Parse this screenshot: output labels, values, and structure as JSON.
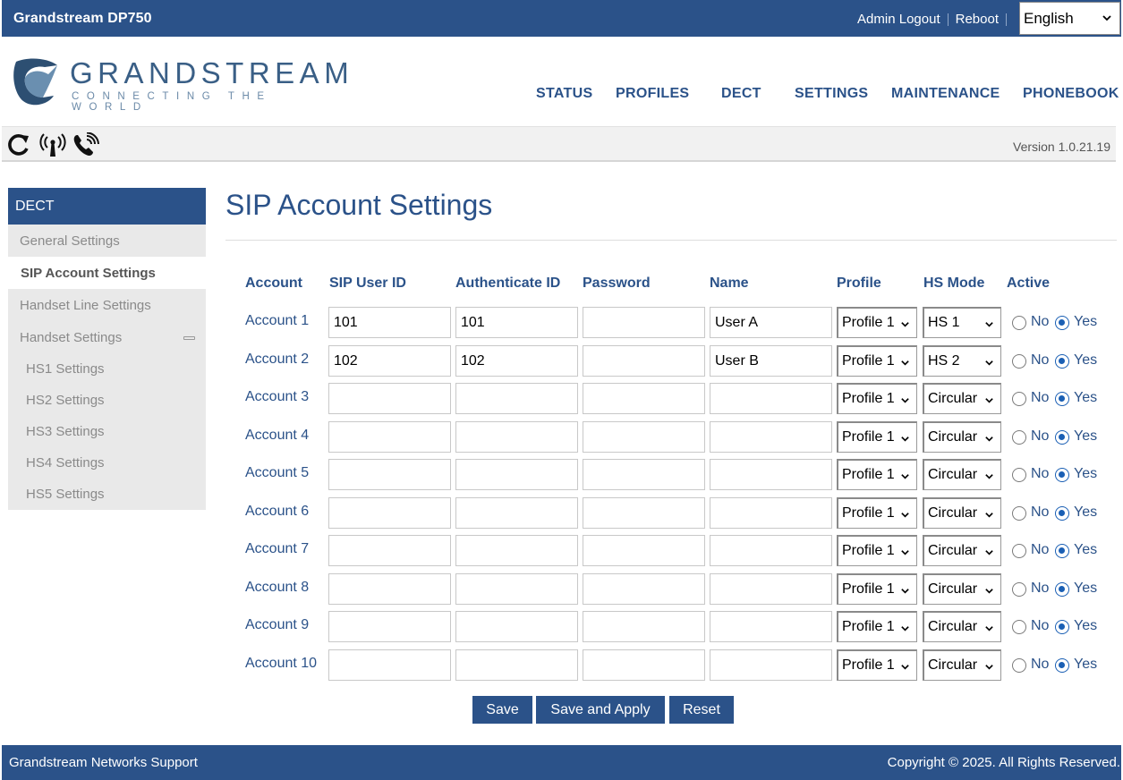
{
  "topbar": {
    "product": "Grandstream DP750",
    "admin_logout": "Admin Logout",
    "reboot": "Reboot",
    "language": "English"
  },
  "logo": {
    "word": "GRANDSTREAM",
    "tagline": "CONNECTING THE WORLD"
  },
  "nav": [
    "STATUS",
    "PROFILES",
    "DECT",
    "SETTINGS",
    "MAINTENANCE",
    "PHONEBOOK"
  ],
  "toolbar": {
    "icons": [
      "refresh-icon",
      "antenna-icon",
      "phone-ringing-icon"
    ],
    "version": "Version 1.0.21.19"
  },
  "sidebar": {
    "header": "DECT",
    "items": [
      "General Settings",
      "SIP Account Settings",
      "Handset Line Settings",
      "Handset Settings",
      "HS1 Settings",
      "HS2 Settings",
      "HS3 Settings",
      "HS4 Settings",
      "HS5 Settings"
    ]
  },
  "main": {
    "title": "SIP Account Settings",
    "columns": [
      "Account",
      "SIP User ID",
      "Authenticate ID",
      "Password",
      "Name",
      "Profile",
      "HS Mode",
      "Active"
    ],
    "radio_labels": {
      "no": "No",
      "yes": "Yes"
    },
    "rows": [
      {
        "account": "Account 1",
        "sip_user_id": "101",
        "auth_id": "101",
        "password": "",
        "name": "User A",
        "profile": "Profile 1",
        "hs_mode": "HS 1",
        "active": "Yes"
      },
      {
        "account": "Account 2",
        "sip_user_id": "102",
        "auth_id": "102",
        "password": "",
        "name": "User B",
        "profile": "Profile 1",
        "hs_mode": "HS 2",
        "active": "Yes"
      },
      {
        "account": "Account 3",
        "sip_user_id": "",
        "auth_id": "",
        "password": "",
        "name": "",
        "profile": "Profile 1",
        "hs_mode": "Circular",
        "active": "Yes"
      },
      {
        "account": "Account 4",
        "sip_user_id": "",
        "auth_id": "",
        "password": "",
        "name": "",
        "profile": "Profile 1",
        "hs_mode": "Circular",
        "active": "Yes"
      },
      {
        "account": "Account 5",
        "sip_user_id": "",
        "auth_id": "",
        "password": "",
        "name": "",
        "profile": "Profile 1",
        "hs_mode": "Circular",
        "active": "Yes"
      },
      {
        "account": "Account 6",
        "sip_user_id": "",
        "auth_id": "",
        "password": "",
        "name": "",
        "profile": "Profile 1",
        "hs_mode": "Circular",
        "active": "Yes"
      },
      {
        "account": "Account 7",
        "sip_user_id": "",
        "auth_id": "",
        "password": "",
        "name": "",
        "profile": "Profile 1",
        "hs_mode": "Circular",
        "active": "Yes"
      },
      {
        "account": "Account 8",
        "sip_user_id": "",
        "auth_id": "",
        "password": "",
        "name": "",
        "profile": "Profile 1",
        "hs_mode": "Circular",
        "active": "Yes"
      },
      {
        "account": "Account 9",
        "sip_user_id": "",
        "auth_id": "",
        "password": "",
        "name": "",
        "profile": "Profile 1",
        "hs_mode": "Circular",
        "active": "Yes"
      },
      {
        "account": "Account 10",
        "sip_user_id": "",
        "auth_id": "",
        "password": "",
        "name": "",
        "profile": "Profile 1",
        "hs_mode": "Circular",
        "active": "Yes"
      }
    ],
    "buttons": {
      "save": "Save",
      "save_apply": "Save and Apply",
      "reset": "Reset"
    }
  },
  "footer": {
    "left": "Grandstream Networks Support",
    "right": "Copyright © 2025. All Rights Reserved."
  },
  "colors": {
    "primary": "#2b5289",
    "radio": "#1a5fb4"
  }
}
